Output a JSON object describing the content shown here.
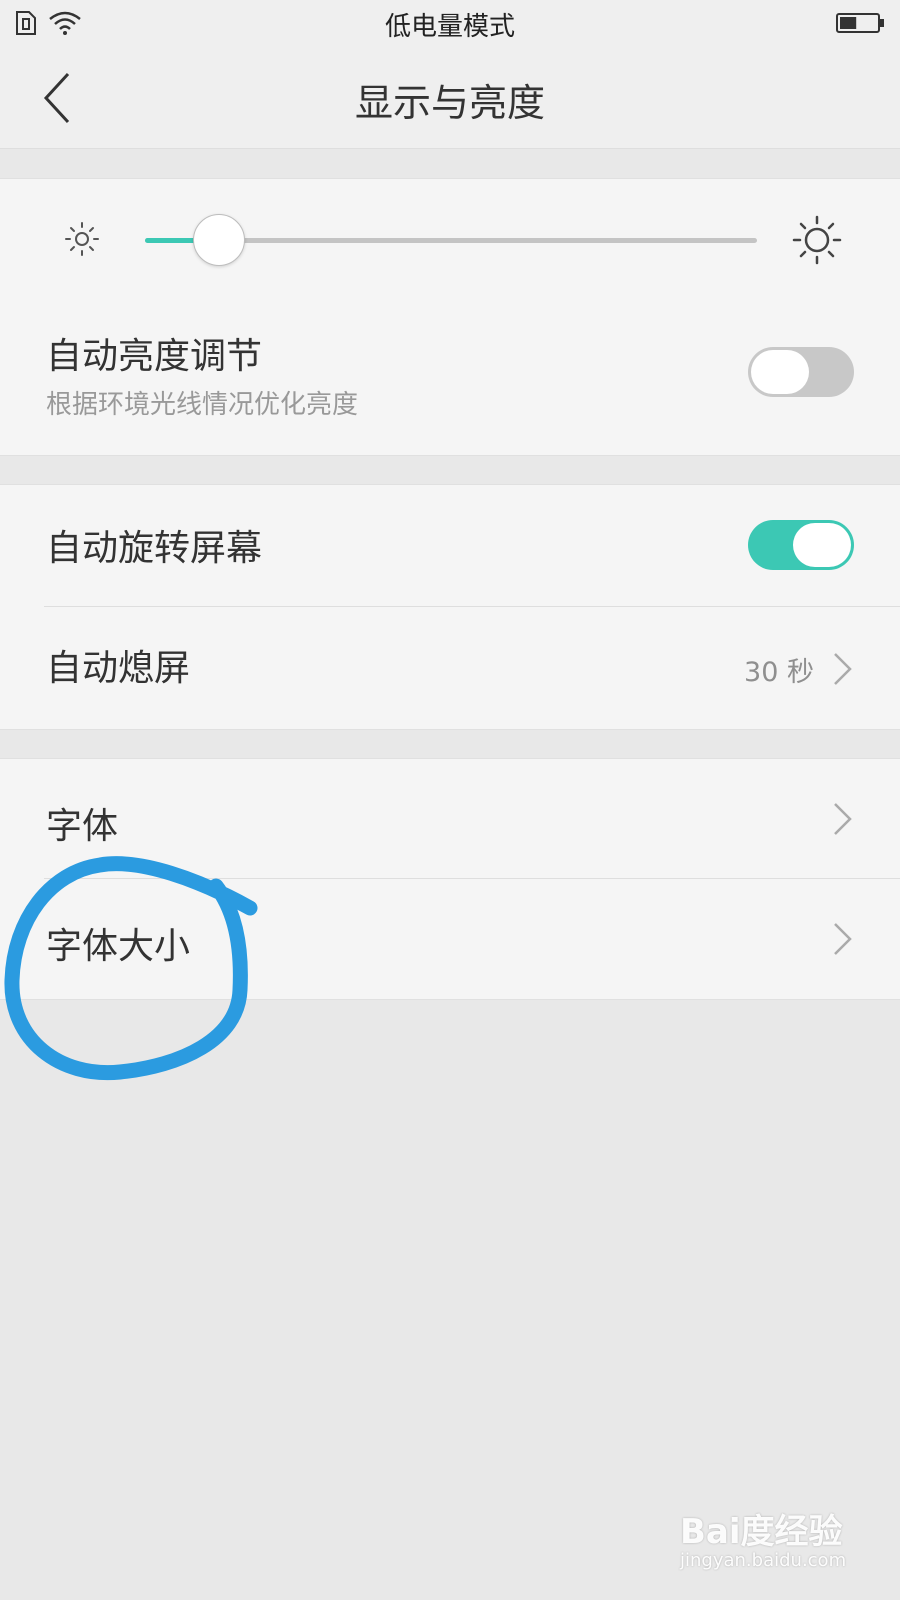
{
  "status_bar": {
    "mode_text": "低电量模式",
    "battery_level": 0.45,
    "icons": [
      "sim-card-icon",
      "wifi-icon",
      "battery-icon"
    ]
  },
  "nav": {
    "title": "显示与亮度",
    "back_icon": "chevron-left-icon"
  },
  "brightness": {
    "level": 0.12,
    "accent_color": "#3cc8b4",
    "icons": [
      "sun-small-icon",
      "sun-large-icon"
    ]
  },
  "auto_brightness": {
    "label": "自动亮度调节",
    "description": "根据环境光线情况优化亮度",
    "enabled": false
  },
  "auto_rotate": {
    "label": "自动旋转屏幕",
    "enabled": true
  },
  "auto_sleep": {
    "label": "自动熄屏",
    "value": "30 秒"
  },
  "font": {
    "label": "字体"
  },
  "font_size": {
    "label": "字体大小"
  },
  "annotation": {
    "color": "#2b9be0"
  },
  "watermark": {
    "brand": "Bai度经验",
    "url": "jingyan.baidu.com"
  }
}
